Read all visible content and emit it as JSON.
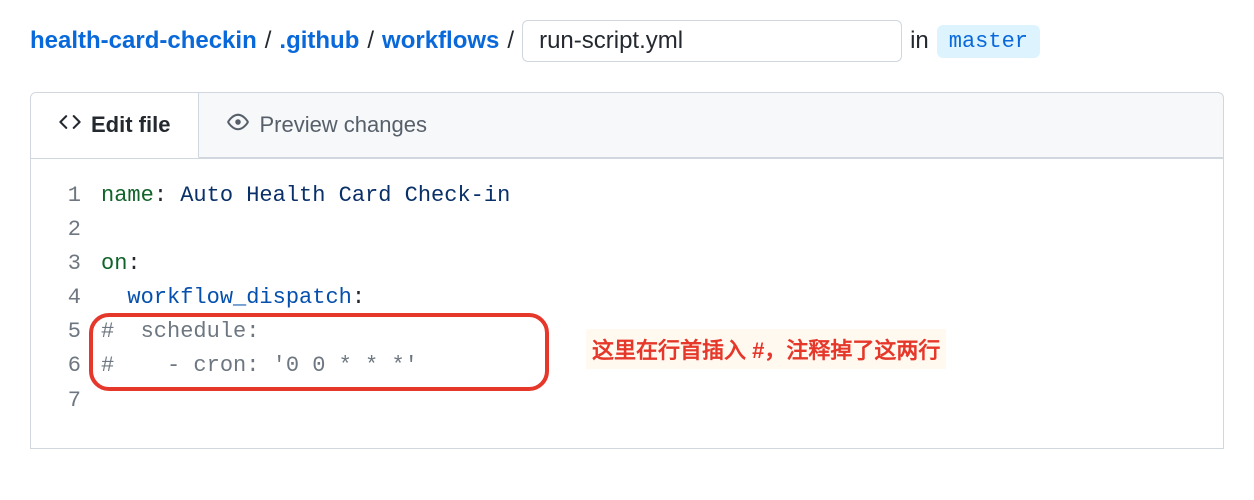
{
  "breadcrumb": {
    "repo": "health-card-checkin",
    "dir1": ".github",
    "dir2": "workflows",
    "sep": "/",
    "filename_value": "run-script.yml",
    "in_label": "in",
    "branch": "master"
  },
  "tabs": {
    "edit": "Edit file",
    "preview": "Preview changes"
  },
  "code": {
    "lines": [
      {
        "num": "1",
        "tokens": [
          {
            "cls": "tok-key",
            "t": "name"
          },
          {
            "cls": "tok-punc",
            "t": ": "
          },
          {
            "cls": "tok-str",
            "t": "Auto Health Card Check-in"
          }
        ]
      },
      {
        "num": "2",
        "tokens": []
      },
      {
        "num": "3",
        "tokens": [
          {
            "cls": "tok-key",
            "t": "on"
          },
          {
            "cls": "tok-punc",
            "t": ":"
          }
        ]
      },
      {
        "num": "4",
        "tokens": [
          {
            "cls": "tok-plain",
            "t": "  "
          },
          {
            "cls": "tok-ent",
            "t": "workflow_dispatch"
          },
          {
            "cls": "tok-punc",
            "t": ":"
          }
        ]
      },
      {
        "num": "5",
        "tokens": [
          {
            "cls": "tok-comment",
            "t": "#  schedule:"
          }
        ]
      },
      {
        "num": "6",
        "tokens": [
          {
            "cls": "tok-comment",
            "t": "#    - cron: '0 0 * * *'"
          }
        ]
      },
      {
        "num": "7",
        "tokens": []
      }
    ]
  },
  "annotation": {
    "text": "这里在行首插入 #，注释掉了这两行"
  }
}
